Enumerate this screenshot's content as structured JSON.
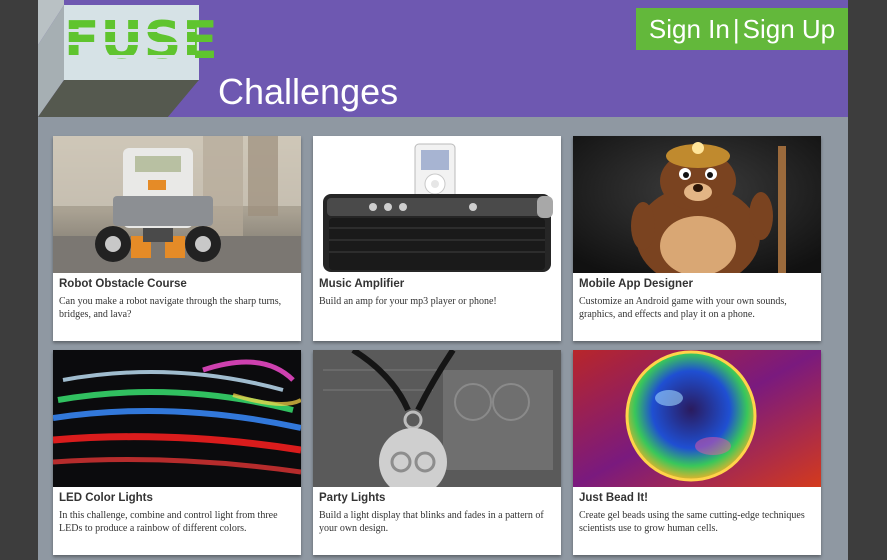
{
  "header": {
    "logo_text": "FUSE",
    "title": "Challenges",
    "sign_in": "Sign In",
    "separator": "|",
    "sign_up": "Sign Up"
  },
  "colors": {
    "header_purple": "#6e58b1",
    "logo_green": "#5fc42e",
    "auth_green": "#63b83b",
    "page_background": "#8f98a2"
  },
  "challenges": [
    {
      "title": "Robot Obstacle Course",
      "description": "Can you make a robot navigate through the sharp turns, bridges, and lava?",
      "image": "lego-robot-photo"
    },
    {
      "title": "Music Amplifier",
      "description": "Build an amp for your mp3 player or phone!",
      "image": "ipod-speaker-dock-photo"
    },
    {
      "title": "Mobile App Designer",
      "description": "Customize an Android game with your own sounds, graphics, and effects and play it on a phone.",
      "image": "cartoon-mole-miner-render"
    },
    {
      "title": "LED Color Lights",
      "description": "In this challenge, combine and control light from three LEDs to produce a rainbow of different colors.",
      "image": "rgb-led-strip-photo"
    },
    {
      "title": "Party Lights",
      "description": "Build a light display that blinks and fades in a pattern of your own design.",
      "image": "arduino-pendant-photo"
    },
    {
      "title": "Just Bead It!",
      "description": "Create gel beads using the same cutting-edge techniques scientists use to grow human cells.",
      "image": "colorful-gel-bead-micrograph"
    }
  ]
}
